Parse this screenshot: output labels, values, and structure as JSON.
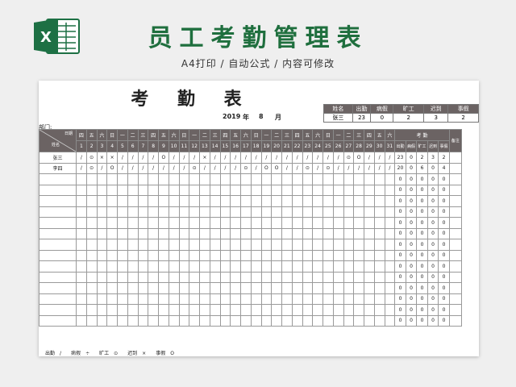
{
  "banner": {
    "title": "员工考勤管理表",
    "subtitle": "A4打印 / 自动公式 / 内容可修改"
  },
  "sheet": {
    "title": "考 勤 表",
    "year": "2019",
    "year_unit": "年",
    "month": "8",
    "month_unit": "月",
    "dept_label": "部门:"
  },
  "summary": {
    "headers": [
      "姓名",
      "出勤",
      "病假",
      "旷工",
      "迟到",
      "事假"
    ],
    "values": [
      "张三",
      "23",
      "0",
      "2",
      "3",
      "2"
    ]
  },
  "grid": {
    "header_date_label": "日期",
    "header_name_label": "姓名",
    "weekdays": [
      "四",
      "五",
      "六",
      "日",
      "一",
      "二",
      "三",
      "四",
      "五",
      "六",
      "日",
      "一",
      "二",
      "三",
      "四",
      "五",
      "六",
      "日",
      "一",
      "二",
      "三",
      "四",
      "五",
      "六",
      "日",
      "一",
      "二",
      "三",
      "四",
      "五",
      "六"
    ],
    "days": [
      "1",
      "2",
      "3",
      "4",
      "5",
      "6",
      "7",
      "8",
      "9",
      "10",
      "11",
      "12",
      "13",
      "14",
      "15",
      "16",
      "17",
      "18",
      "19",
      "20",
      "21",
      "22",
      "23",
      "24",
      "25",
      "26",
      "27",
      "28",
      "29",
      "30",
      "31"
    ],
    "kaoqin_label": "考 勤",
    "remark_label": "备注",
    "summary_headers": [
      "出勤",
      "病假",
      "旷工",
      "迟到",
      "事假"
    ],
    "rows": [
      {
        "name": "张三",
        "marks": [
          "/",
          "⊙",
          "×",
          "×",
          "/",
          "/",
          "/",
          "/",
          "O",
          "/",
          "/",
          "/",
          "×",
          "/",
          "/",
          "/",
          "/",
          "/",
          "/",
          "/",
          "/",
          "/",
          "/",
          "/",
          "/",
          "/",
          "⊙",
          "O",
          "/",
          "/",
          "/"
        ],
        "totals": [
          "23",
          "0",
          "2",
          "3",
          "2"
        ]
      },
      {
        "name": "李四",
        "marks": [
          "/",
          "⊙",
          "/",
          "O",
          "/",
          "/",
          "/",
          "/",
          "/",
          "/",
          "/",
          "⊙",
          "/",
          "/",
          "/",
          "/",
          "⊙",
          "/",
          "O",
          "O",
          "/",
          "/",
          "⊙",
          "/",
          "⊙",
          "/",
          "/",
          "/",
          "/",
          "/",
          "/"
        ],
        "totals": [
          "20",
          "0",
          "6",
          "0",
          "4"
        ]
      }
    ],
    "empty_rows": 14,
    "empty_totals": [
      "0",
      "0",
      "0",
      "0",
      "0"
    ]
  },
  "legend": [
    {
      "label": "出勤",
      "symbol": "/"
    },
    {
      "label": "病假",
      "symbol": "÷"
    },
    {
      "label": "旷工",
      "symbol": "⊙"
    },
    {
      "label": "迟到",
      "symbol": "×"
    },
    {
      "label": "事假",
      "symbol": "O"
    }
  ],
  "colors": {
    "brand": "#1f6f3e",
    "header_bg": "#6b6363",
    "excel_green": "#1d7044"
  }
}
